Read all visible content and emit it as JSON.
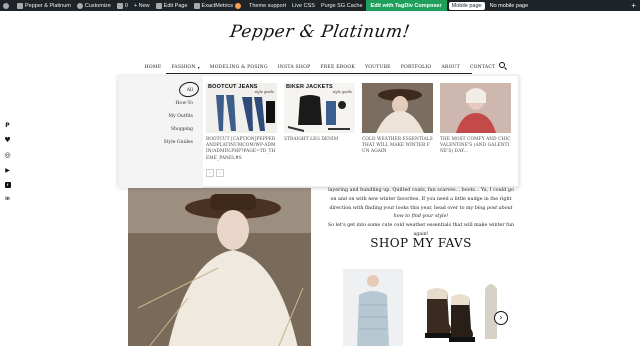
{
  "adminbar": {
    "site_name": "Pepper & Platinum",
    "customize": "Customize",
    "comments_count": "0",
    "new": "New",
    "edit_page": "Edit Page",
    "exactmetrics": "ExactMetrics",
    "theme_support": "Theme support",
    "live_css": "Live CSS",
    "purge_cache": "Purge SG Cache",
    "tagdiv": "Edit with TagDiv Composer",
    "mobile_page": "Mobile page",
    "no_mobile_page": "No mobile page",
    "plus": "+"
  },
  "header": {
    "logo": "Pepper & Platinum!"
  },
  "nav": {
    "items": [
      {
        "label": "HOME"
      },
      {
        "label": "FASHION"
      },
      {
        "label": "MODELING & POSING"
      },
      {
        "label": "INSTA SHOP"
      },
      {
        "label": "FREE EBOOK"
      },
      {
        "label": "YOUTUBE"
      },
      {
        "label": "PORTFOLIO"
      },
      {
        "label": "ABOUT"
      },
      {
        "label": "CONTACT"
      }
    ],
    "fashion_chevron": "▾"
  },
  "dropdown": {
    "subnav": [
      {
        "label": "All"
      },
      {
        "label": "How-To"
      },
      {
        "label": "My Outfits"
      },
      {
        "label": "Shopping"
      },
      {
        "label": "Style Guides"
      }
    ],
    "cards": [
      {
        "title": "BOOTCUT [CAPTION]PEPPERANDPLATINUMCOM/WP-ADMIN/ADMIN.PHP?PAGE=TD_THEME_PANEL#S",
        "thumb_label": "BOOTCUT JEANS",
        "thumb_sub": "style guide"
      },
      {
        "title": "STRAIGHT LEG DENIM",
        "thumb_label": "BIKER JACKETS",
        "thumb_sub": "style guide"
      },
      {
        "title": "COLD WEATHER ESSENTIALS THAT WILL MAKE WINTER FUN AGAIN",
        "thumb_label": "",
        "thumb_sub": ""
      },
      {
        "title": "THE MOST COMFY AND CHIC VALENTINE'S (AND GALENTINE'S) DAY...",
        "thumb_label": "",
        "thumb_sub": ""
      }
    ],
    "pager_prev": "‹",
    "pager_next": "›"
  },
  "social": {
    "icons": [
      "pinterest-icon",
      "heart-icon",
      "instagram-icon",
      "youtube-icon",
      "facebook-icon",
      "linkedin-icon"
    ],
    "pinterest": "P",
    "heart": "♥",
    "instagram": "◎",
    "youtube": "▶",
    "facebook": "f",
    "linkedin": "in"
  },
  "article": {
    "line1": "layering and bundling up. Quilted coats, fun scarves... boots... Ya, I could go",
    "line2": "on and on with new winter favorites. If you need a little nudge in the right",
    "line3": "direction with finding your looks this year, head over to my",
    "link1": "blog post about",
    "link2": "how to find your style!",
    "line4": "So let's get into some cute cold weather essentials that will make winter fun",
    "line5": "again!",
    "shop_title": "SHOP MY FAVS"
  },
  "carousel": {
    "next": "›"
  },
  "colors": {
    "adminbar_bg": "#1d2327",
    "tagdiv_green": "#1f9f5c"
  }
}
